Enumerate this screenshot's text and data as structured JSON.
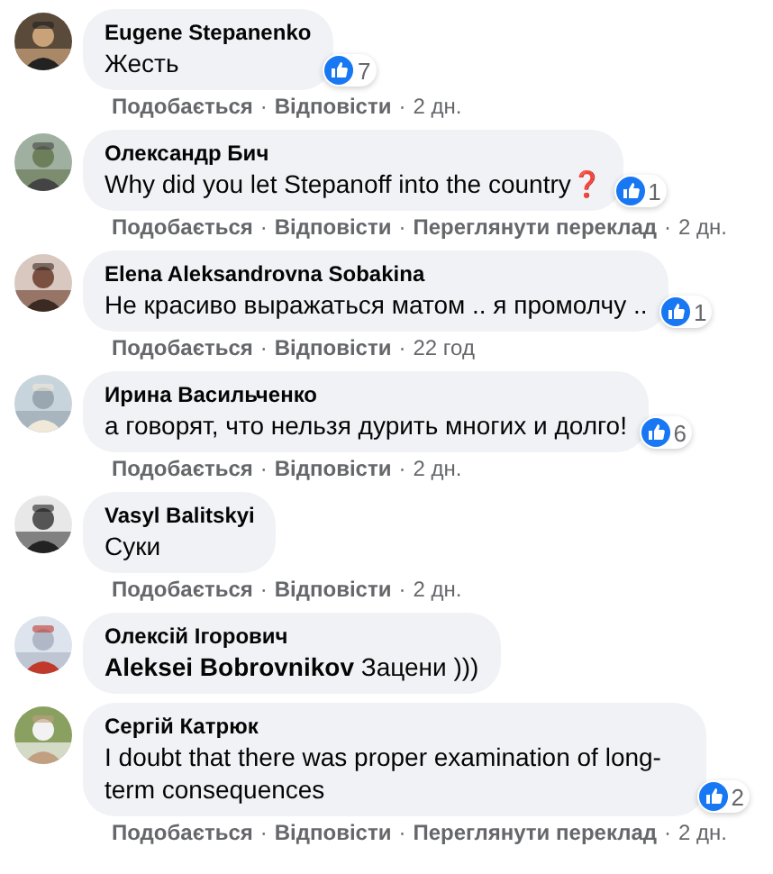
{
  "separator": "·",
  "comments": [
    {
      "author": "Eugene Stepanenko",
      "text": "Жесть",
      "reactions": "7",
      "actions": [
        "Подобається",
        "Відповісти"
      ],
      "time": "2 дн."
    },
    {
      "author": "Олександр Бич",
      "text": "Why did you let Stepanoff into the country❓",
      "reactions": "1",
      "actions": [
        "Подобається",
        "Відповісти",
        "Переглянути переклад"
      ],
      "time": "2 дн."
    },
    {
      "author": "Elena Aleksandrovna Sobakina",
      "text": "Не красиво выражаться матом .. я промолчу ..",
      "reactions": "1",
      "actions": [
        "Подобається",
        "Відповісти"
      ],
      "time": "22 год"
    },
    {
      "author": "Ирина Васильченко",
      "text": "а говорят, что нельзя дурить многих и долго!",
      "reactions": "6",
      "actions": [
        "Подобається",
        "Відповісти"
      ],
      "time": "2 дн."
    },
    {
      "author": "Vasyl Balitskyi",
      "text": "Суки",
      "actions": [
        "Подобається",
        "Відповісти"
      ],
      "time": "2 дн."
    },
    {
      "author": "Олексій Ігорович",
      "text": "**Aleksei Bobrovnikov** Зацени )))"
    },
    {
      "author": "Сергій Катрюк",
      "text": "I doubt that there was proper examination of long-term consequences",
      "reactions": "2",
      "actions": [
        "Подобається",
        "Відповісти",
        "Переглянути переклад"
      ],
      "time": "2 дн."
    }
  ]
}
